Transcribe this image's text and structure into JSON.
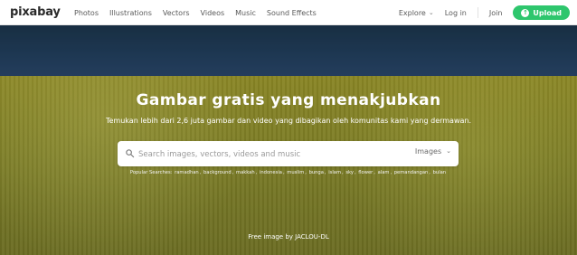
{
  "brand": {
    "logo_text": "pixabay"
  },
  "nav": {
    "items": [
      {
        "label": "Photos"
      },
      {
        "label": "Illustrations"
      },
      {
        "label": "Vectors"
      },
      {
        "label": "Videos"
      },
      {
        "label": "Music"
      },
      {
        "label": "Sound Effects"
      }
    ],
    "explore_label": "Explore",
    "login_label": "Log in",
    "join_label": "Join",
    "upload_label": "Upload"
  },
  "hero": {
    "title": "Gambar gratis yang menakjubkan",
    "subtitle": "Temukan lebih dari 2,6 juta gambar dan video yang dibagikan oleh komunitas kami yang dermawan.",
    "search_placeholder": "Search images, vectors, videos and music",
    "search_type": "Images",
    "popular_label": "Popular Searches:",
    "popular_tags": [
      "ramadhan",
      "background",
      "makkah",
      "indonesia",
      "muslim",
      "bunga",
      "islam",
      "sky",
      "flower",
      "alam",
      "pemandangan",
      "bulan"
    ],
    "credit": "Free image by JACLOU-DL"
  },
  "colors": {
    "accent": "#2ec66d",
    "text_dark": "#2b2b2b",
    "nav_text": "#5a5a5a"
  },
  "icons": {
    "search": "search-icon",
    "chevron": "chevron-down-icon",
    "upload": "upload-icon"
  }
}
